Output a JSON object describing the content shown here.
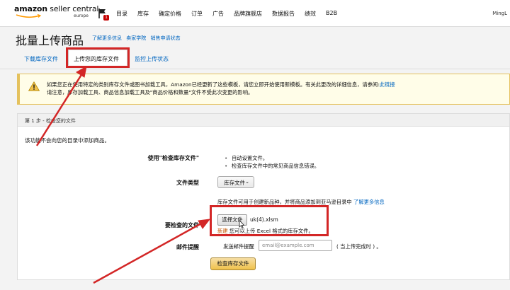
{
  "header": {
    "logo_main_bold": "amazon",
    "logo_main_rest": " seller central",
    "logo_sub": "europe",
    "notification_count": "1",
    "nav": [
      "目录",
      "库存",
      "确定价格",
      "订单",
      "广告",
      "品牌旗舰店",
      "数据报告",
      "绩效",
      "B2B"
    ],
    "user": "MingL"
  },
  "page": {
    "title": "批量上传商品",
    "links": [
      "了解更多信息",
      "卖家学院",
      "销售申请状态"
    ]
  },
  "tabs": {
    "download": "下载库存文件",
    "upload": "上传您的库存文件",
    "monitor": "监控上传状态"
  },
  "alert": {
    "line1": "如果您正在使用特定的类别库存文件或图书加载工具，Amazon已经更新了这些模板，请您立即开始使用新模板。有关此更改的详细信息，请参阅:",
    "link": "此链接",
    "line2": "请注意，库存加载工具、商品信息加载工具及\"商品价格和数量\"文件不受此次变更的影响。"
  },
  "step": {
    "header": "第 1 步 - 检查您的文件",
    "description": "该功能不会向您的目录中添加商品。",
    "use_check_label": "使用\"检查库存文件\"",
    "bullets": [
      "自动设置文件。",
      "检查库存文件中的常见商品信息错误。"
    ],
    "file_type_label": "文件类型",
    "file_type_value": "库存文件",
    "hint": "库存文件可用于创建新品种，并将商品添加到亚马逊目录中",
    "hint_link": "了解更多信息",
    "check_file_label": "要检查的文件",
    "choose_button": "选择文件",
    "file_name": "uk(4).xlsm",
    "new_tag": "新建",
    "new_note": "您可以上传 Excel 格式的库存文件。",
    "email_section_label": "邮件提醒",
    "email_label": "发送邮件提醒",
    "email_placeholder": "email@example.com",
    "email_suffix": "( 当上传完成时 ) 。",
    "check_button": "检查库存文件"
  },
  "colors": {
    "link": "#0066c0",
    "highlight": "#d32626",
    "primary_button": "#f0c14b",
    "alert_border": "#e4c15d"
  }
}
